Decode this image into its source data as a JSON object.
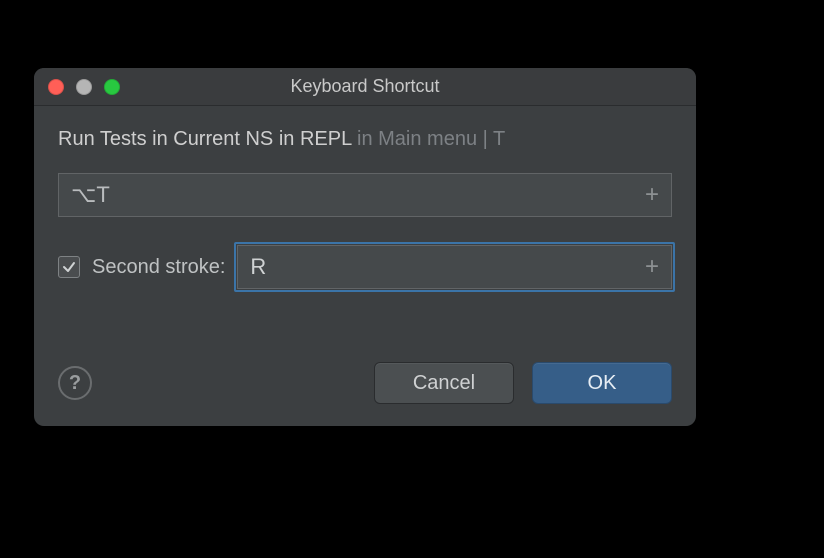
{
  "window": {
    "title": "Keyboard Shortcut"
  },
  "description": {
    "action": "Run Tests in Current NS in REPL",
    "context": " in Main menu | T"
  },
  "first_stroke": {
    "value": "⌥T",
    "add_hint": "+"
  },
  "second_stroke": {
    "checked": true,
    "label": "Second stroke:",
    "value": "R",
    "add_hint": "+"
  },
  "buttons": {
    "cancel": "Cancel",
    "ok": "OK",
    "help": "?"
  }
}
